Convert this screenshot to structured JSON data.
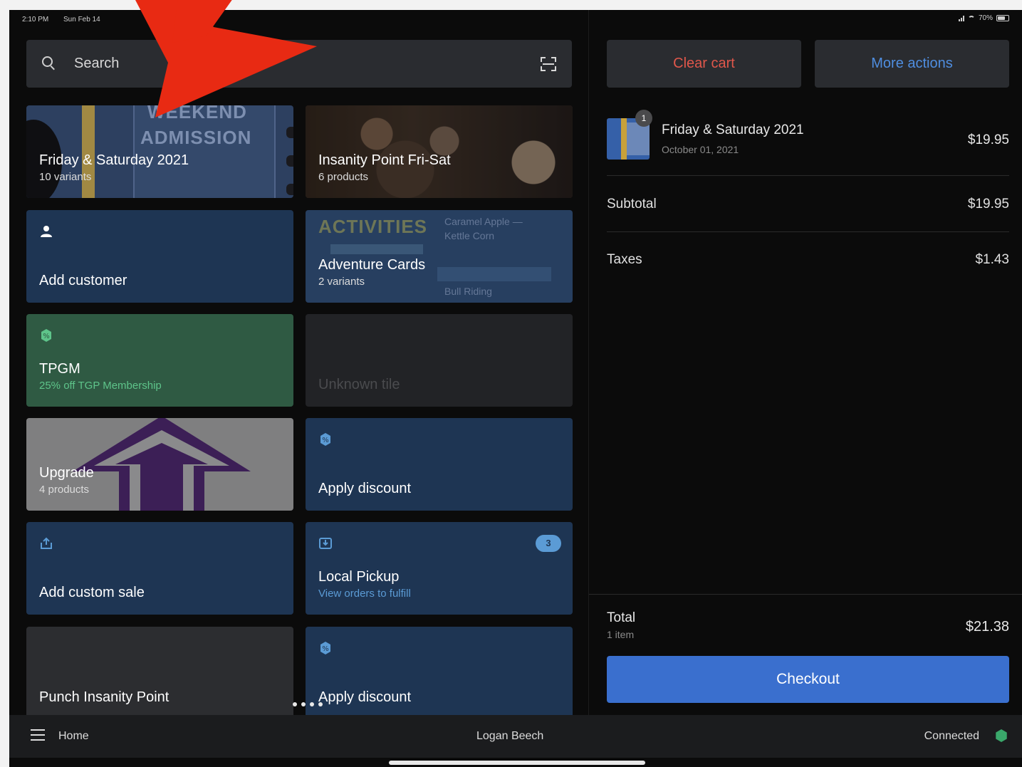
{
  "status_bar": {
    "time": "2:10 PM",
    "date": "Sun Feb 14",
    "battery": "70%"
  },
  "search": {
    "placeholder": "Search"
  },
  "tiles": {
    "admission": {
      "title": "Friday & Saturday 2021",
      "subtitle": "10 variants",
      "banner_line1": "WEEKEND",
      "banner_line2": "ADMISSION"
    },
    "insanity": {
      "title": "Insanity Point Fri-Sat",
      "subtitle": "6 products"
    },
    "add_customer": {
      "title": "Add customer"
    },
    "adventure": {
      "title": "Adventure Cards",
      "subtitle": "2 variants",
      "art_word": "ACTIVITIES",
      "art_line1": "Caramel Apple —",
      "art_line2": "Kettle Corn",
      "art_line3": "Bull Riding"
    },
    "tpgm": {
      "title": "TPGM",
      "subtitle": "25% off TGP Membership"
    },
    "unknown": {
      "title": "Unknown tile"
    },
    "upgrade": {
      "title": "Upgrade",
      "subtitle": "4 products"
    },
    "apply_discount_1": {
      "title": "Apply discount"
    },
    "custom_sale": {
      "title": "Add custom sale"
    },
    "local_pickup": {
      "title": "Local Pickup",
      "subtitle": "View orders to fulfill",
      "badge": "3"
    },
    "punch": {
      "title": "Punch Insanity Point"
    },
    "apply_discount_2": {
      "title": "Apply discount"
    }
  },
  "cart": {
    "clear_label": "Clear cart",
    "more_label": "More actions",
    "item": {
      "name": "Friday & Saturday 2021",
      "date": "October 01, 2021",
      "price": "$19.95",
      "qty": "1"
    },
    "subtotal_label": "Subtotal",
    "subtotal_value": "$19.95",
    "taxes_label": "Taxes",
    "taxes_value": "$1.43",
    "total_label": "Total",
    "total_items": "1 item",
    "total_value": "$21.38",
    "checkout_label": "Checkout"
  },
  "bottom_bar": {
    "home_label": "Home",
    "user_label": "Logan Beech",
    "status_label": "Connected"
  },
  "colors": {
    "accent": "#3a6fce",
    "danger": "#e0574b",
    "link": "#4f8ee0",
    "success": "#3aa86b",
    "annotation": "#e82a13"
  }
}
